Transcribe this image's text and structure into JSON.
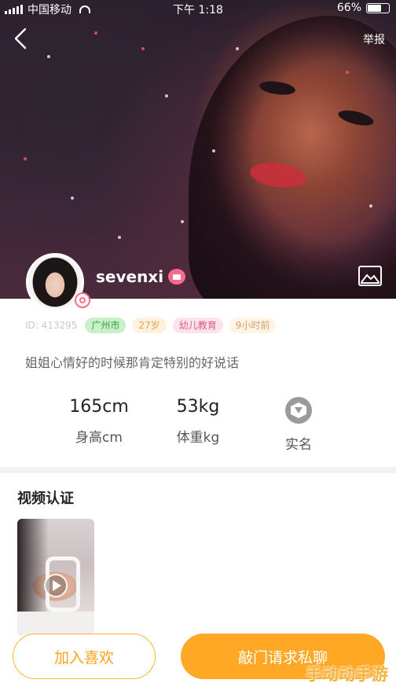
{
  "status_bar": {
    "carrier": "中国移动",
    "time": "下午 1:18",
    "battery": "66%"
  },
  "header": {
    "report_label": "举报"
  },
  "profile": {
    "username": "sevenxi",
    "id_text": "ID: 413295",
    "tags": [
      "广州市",
      "27岁",
      "幼儿教育",
      "9小时前"
    ],
    "bio": "姐姐心情好的时候那肯定特别的好说话"
  },
  "stats": {
    "height_value": "165cm",
    "height_label": "身高cm",
    "weight_value": "53kg",
    "weight_label": "体重kg",
    "verified_label": "实名"
  },
  "video_section": {
    "title": "视频认证"
  },
  "actions": {
    "like_label": "加入喜欢",
    "chat_label": "敲门请求私聊"
  },
  "watermark": "手动动手游",
  "colors": {
    "accent": "#ffa826",
    "city_tag": "#35a043",
    "edu_tag": "#e35a86",
    "badge_pink": "#ff6a8c"
  }
}
